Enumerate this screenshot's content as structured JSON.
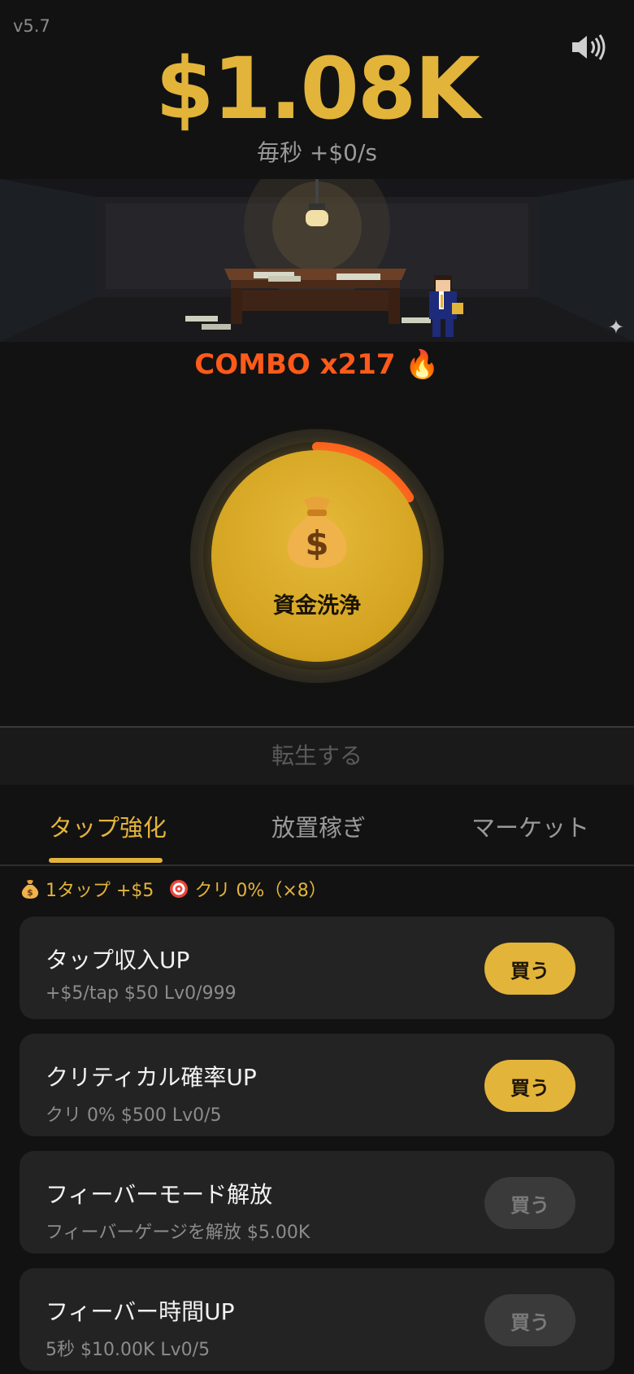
{
  "header": {
    "version": "v5.7",
    "money": "$1.08K",
    "rate": "毎秒 +$0/s",
    "sound_icon": "speaker-icon"
  },
  "combo": {
    "label": "COMBO x217 🔥",
    "progress": 0.16
  },
  "tap_button": {
    "label": "資金洗浄",
    "icon": "money-bag-icon"
  },
  "rebirth": {
    "label": "転生する"
  },
  "tabs": [
    {
      "label": "タップ強化",
      "active": true
    },
    {
      "label": "放置稼ぎ",
      "active": false
    },
    {
      "label": "マーケット",
      "active": false
    }
  ],
  "stats": {
    "tap": "1タップ +$5",
    "crit": "クリ 0%（×8）"
  },
  "upgrades": [
    {
      "title": "タップ収入UP",
      "sub": "+$5/tap  $50  Lv0/999",
      "buy": "買う",
      "enabled": true
    },
    {
      "title": "クリティカル確率UP",
      "sub": "クリ 0%  $500  Lv0/5",
      "buy": "買う",
      "enabled": true
    },
    {
      "title": "フィーバーモード解放",
      "sub": "フィーバーゲージを解放  $5.00K",
      "buy": "買う",
      "enabled": false
    },
    {
      "title": "フィーバー時間UP",
      "sub": "5秒  $10.00K  Lv0/5",
      "buy": "買う",
      "enabled": false
    }
  ],
  "colors": {
    "accent": "#e3b43a",
    "combo": "#ff5a1a",
    "bg": "#121212",
    "card": "#232323"
  }
}
